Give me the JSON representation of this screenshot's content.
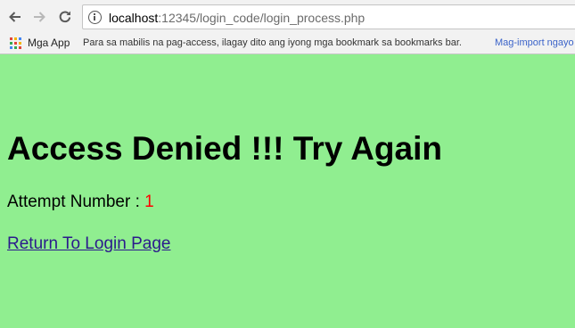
{
  "browser": {
    "address": {
      "host": "localhost",
      "path": ":12345/login_code/login_process.php"
    },
    "bookmarks": {
      "apps_label": "Mga App",
      "hint": "Para sa mabilis na pag-access, ilagay dito ang iyong mga bookmark sa bookmarks bar.",
      "import_label": "Mag-import ngayo"
    }
  },
  "page": {
    "heading": "Access Denied !!! Try Again",
    "attempt_label": "Attempt Number : ",
    "attempt_number": "1",
    "return_link": "Return To Login Page"
  },
  "colors": {
    "background": "#90ee90",
    "attempt_number": "#ff0000",
    "link": "#2b1a8c",
    "bookmark_import": "#3b63c9"
  }
}
